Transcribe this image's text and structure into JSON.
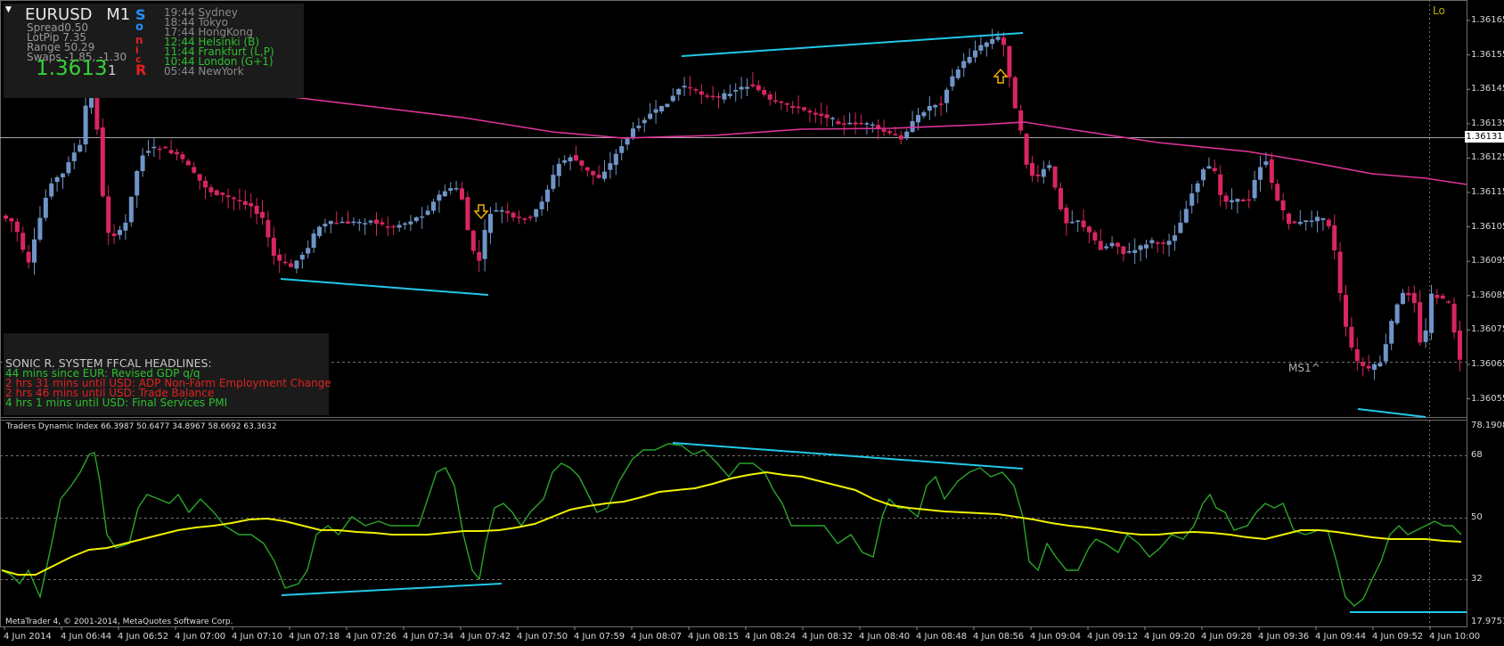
{
  "symbol": {
    "name": "EURUSD",
    "timeframe": "M1"
  },
  "stats": [
    "Spread0.50",
    "LotPip 7.35",
    "Range 50.29",
    "Swaps -1.85, -1.30"
  ],
  "price": {
    "bid": "1.3613",
    "digit": "1"
  },
  "sonic_letters": [
    "S",
    "o",
    "n",
    "i",
    "c",
    "R"
  ],
  "clocks": [
    {
      "text": "19:44 Sydney",
      "color": "#8a8a8a"
    },
    {
      "text": "18:44 Tokyo",
      "color": "#8a8a8a"
    },
    {
      "text": "17:44 HongKong",
      "color": "#8a8a8a"
    },
    {
      "text": "12:44 Helsinki (B)",
      "color": "#2fbf2f"
    },
    {
      "text": "11:44 Frankfurt (L,P)",
      "color": "#2fbf2f"
    },
    {
      "text": "10:44 London (G+1)",
      "color": "#2fbf2f"
    },
    {
      "text": "05:44 NewYork",
      "color": "#8a8a8a"
    }
  ],
  "news": {
    "title": "SONIC R. SYSTEM  FFCAL HEADLINES:",
    "items": [
      {
        "text": "44 mins since EUR: Revised GDP q/q",
        "color": "#2fbf2f"
      },
      {
        "text": "2 hrs 31 mins until USD: ADP Non-Farm Employment Change",
        "color": "#e02020"
      },
      {
        "text": "2 hrs 46 mins until USD: Trade Balance",
        "color": "#e02020"
      },
      {
        "text": "4 hrs 1 mins until USD: Final Services PMI",
        "color": "#2fbf2f"
      }
    ]
  },
  "corner_label": "Lo",
  "ms_label": "MS1^",
  "price_axis": [
    "1.36165",
    "1.36155",
    "1.36145",
    "1.36135",
    "1.36125",
    "1.36115",
    "1.36105",
    "1.36095",
    "1.36085",
    "1.36075",
    "1.36065",
    "1.36055"
  ],
  "current_price_label": "1.36131",
  "indicator": {
    "header": "Traders Dynamic Index 66.3987 50.6477 34.8967 58.6692 63.3632",
    "levels": [
      "78.1908",
      "68",
      "50",
      "32",
      "17.9751"
    ]
  },
  "copyright": "MetaTrader 4, © 2001-2014, MetaQuotes Software Corp.",
  "time_axis": [
    "4 Jun 2014",
    "4 Jun 06:44",
    "4 Jun 06:52",
    "4 Jun 07:00",
    "4 Jun 07:10",
    "4 Jun 07:18",
    "4 Jun 07:26",
    "4 Jun 07:34",
    "4 Jun 07:42",
    "4 Jun 07:50",
    "4 Jun 07:59",
    "4 Jun 08:07",
    "4 Jun 08:15",
    "4 Jun 08:24",
    "4 Jun 08:32",
    "4 Jun 08:40",
    "4 Jun 08:48",
    "4 Jun 08:56",
    "4 Jun 09:04",
    "4 Jun 09:12",
    "4 Jun 09:20",
    "4 Jun 09:28",
    "4 Jun 09:36",
    "4 Jun 09:44",
    "4 Jun 09:52",
    "4 Jun 10:00"
  ],
  "colors": {
    "bull": "#6f95c8",
    "bear": "#d8265f",
    "ma": "#e0349a",
    "tdi_green": "#2aa52a",
    "tdi_yellow": "#f0f000",
    "trend": "#22c8e8",
    "arrow": "#f0b000"
  }
}
